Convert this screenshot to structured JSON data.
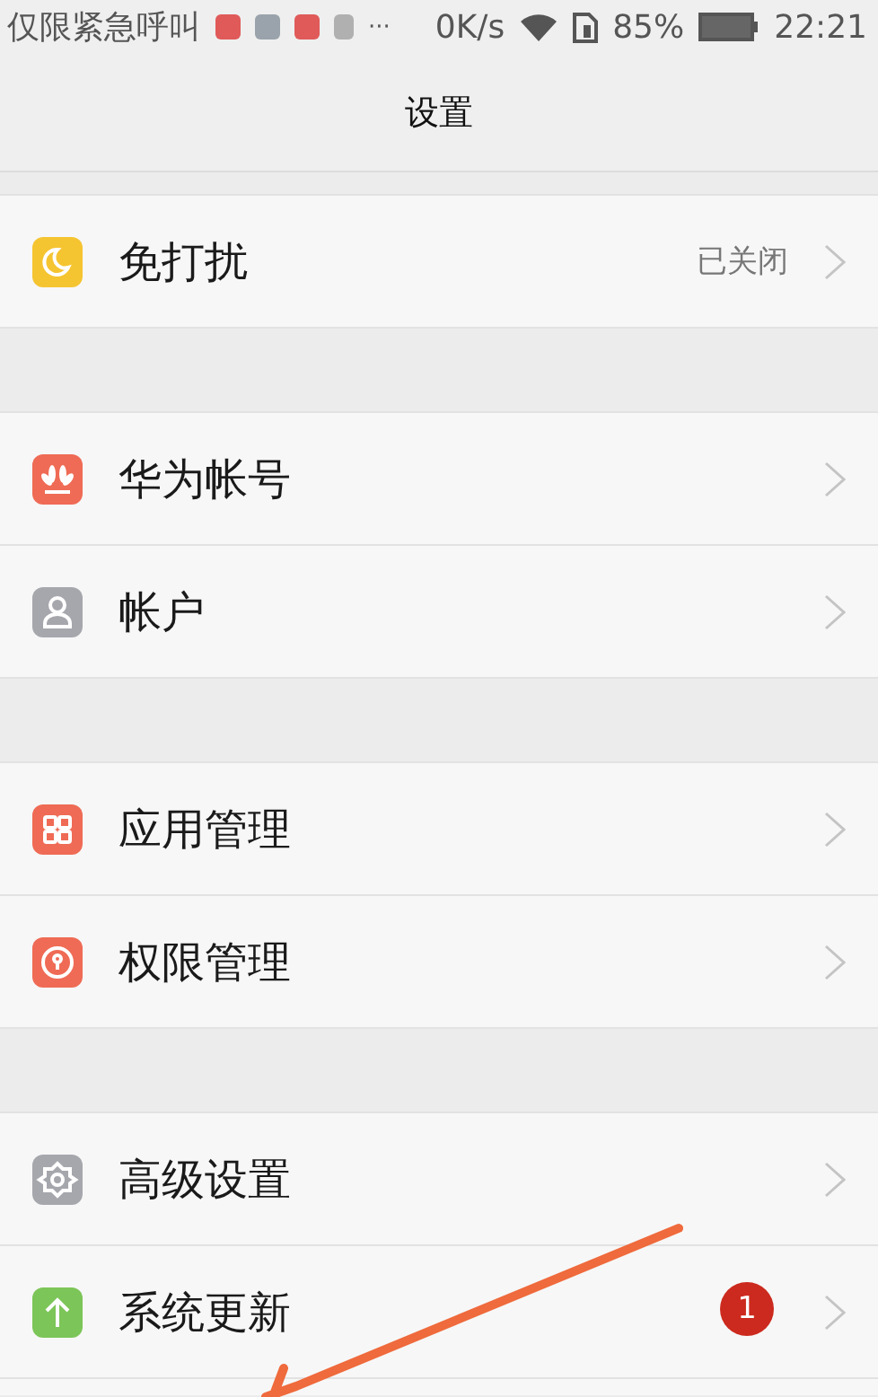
{
  "status_bar": {
    "carrier": "仅限紧急呼叫",
    "more": "···",
    "speed": "0K/s",
    "battery": "85%",
    "time": "22:21"
  },
  "title": "设置",
  "groups": [
    {
      "items": [
        {
          "label": "免打扰",
          "kind": "moon",
          "color": "#f5c431",
          "value": "已关闭"
        }
      ]
    },
    {
      "items": [
        {
          "label": "华为帐号",
          "kind": "flower",
          "color": "#ef6b55"
        },
        {
          "label": "帐户",
          "kind": "person",
          "color": "#a6a7ad"
        }
      ]
    },
    {
      "items": [
        {
          "label": "应用管理",
          "kind": "grid",
          "color": "#ef6b55"
        },
        {
          "label": "权限管理",
          "kind": "lock",
          "color": "#ef6b55"
        }
      ]
    },
    {
      "items": [
        {
          "label": "高级设置",
          "kind": "gear",
          "color": "#a6a7ad"
        },
        {
          "label": "系统更新",
          "kind": "up",
          "color": "#7cc558",
          "badge": "1"
        }
      ]
    }
  ],
  "annotation": {
    "kind": "arrow"
  }
}
